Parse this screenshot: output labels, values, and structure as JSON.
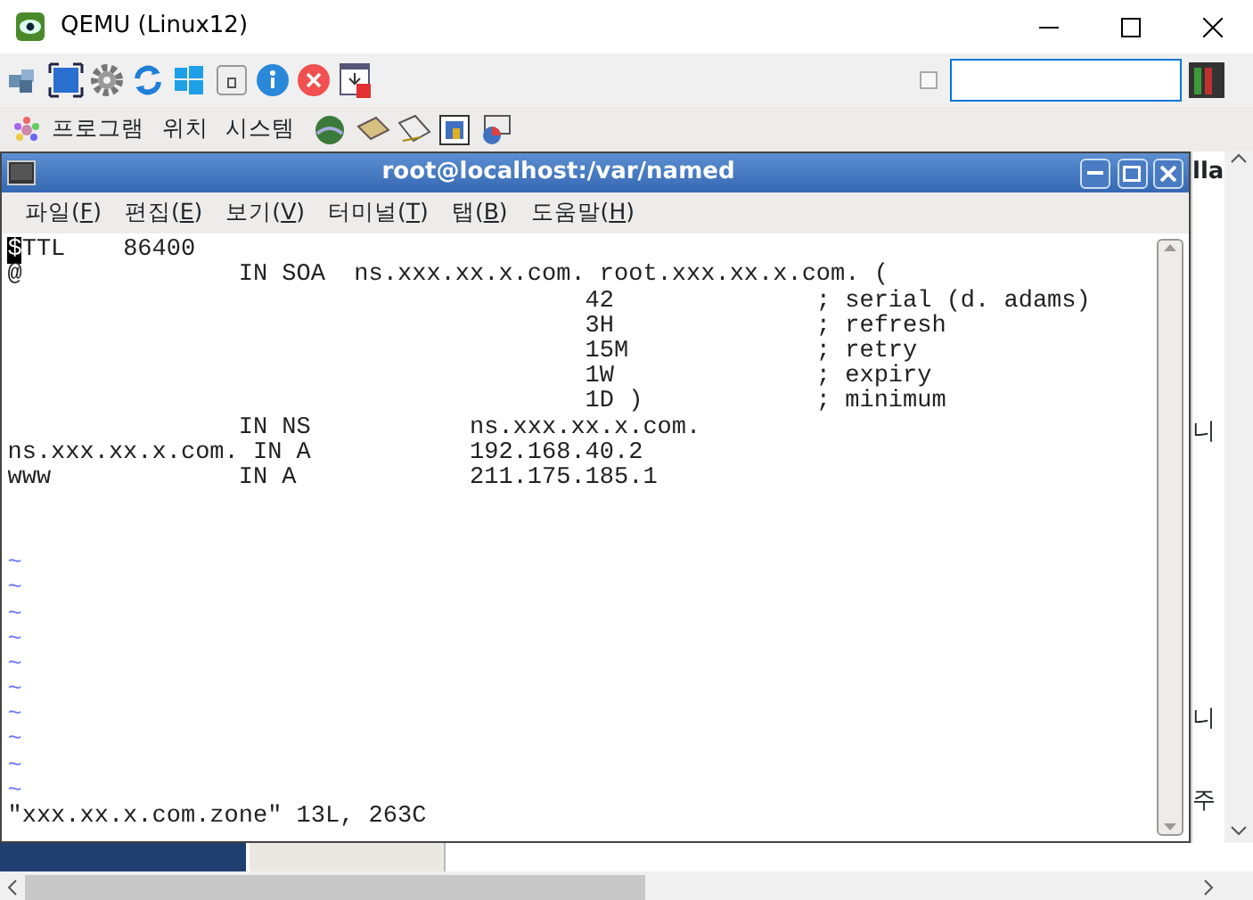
{
  "window": {
    "title": "QEMU (Linux12)"
  },
  "toolbar": {
    "checkbox": {
      "checked": false
    }
  },
  "panel": {
    "menus": [
      "프로그램",
      "위치",
      "시스템"
    ]
  },
  "terminal": {
    "title": "root@localhost:/var/named",
    "menu": [
      {
        "before": "파일(",
        "key": "F",
        "after": ")"
      },
      {
        "before": "편집(",
        "key": "E",
        "after": ")"
      },
      {
        "before": "보기(",
        "key": "V",
        "after": ")"
      },
      {
        "before": "터미널(",
        "key": "T",
        "after": ")"
      },
      {
        "before": "탭(",
        "key": "B",
        "after": ")"
      },
      {
        "before": "도움말(",
        "key": "H",
        "after": ")"
      }
    ],
    "cursor_char": "$",
    "lines": [
      "TTL    86400",
      "@               IN SOA  ns.xxx.xx.x.com. root.xxx.xx.x.com. (",
      "                                        42              ; serial (d. adams)",
      "                                        3H              ; refresh",
      "                                        15M             ; retry",
      "                                        1W              ; expiry",
      "                                        1D )            ; minimum",
      "                IN NS           ns.xxx.xx.x.com.",
      "ns.xxx.xx.x.com. IN A           192.168.40.2",
      "www             IN A            211.175.185.1"
    ],
    "tildes": [
      "~",
      "~",
      "~",
      "~",
      "~",
      "~",
      "~",
      "~",
      "~",
      "~"
    ],
    "status": "\"xxx.xx.x.com.zone\" 13L, 263C"
  },
  "background_fragments": [
    "lla",
    "니",
    "니",
    "주"
  ]
}
